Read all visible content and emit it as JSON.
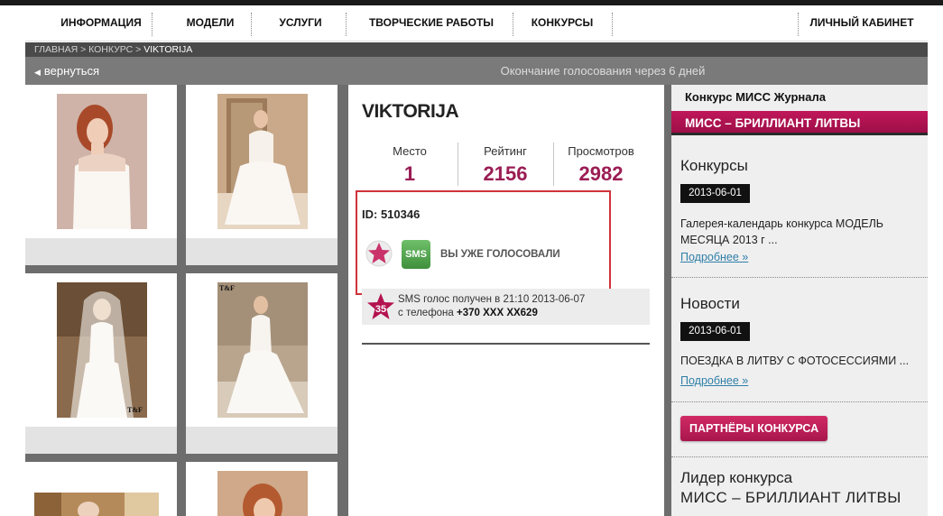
{
  "nav": {
    "items": [
      "ИНФОРМАЦИЯ",
      "МОДЕЛИ",
      "УСЛУГИ",
      "ТВОРЧЕСКИЕ РАБОТЫ",
      "КОНКУРСЫ"
    ],
    "account": "ЛИЧНЫЙ КАБИНЕТ"
  },
  "breadcrumb": {
    "home": "ГЛАВНАЯ",
    "sep": " > ",
    "contest": "КОНКУРС",
    "current": "VIKTORIJA"
  },
  "backbar": {
    "back": "вернуться",
    "voting_end": "Окончание голосования через 6 дней"
  },
  "photos": {
    "watermark": "T&F"
  },
  "profile": {
    "name": "VIKTORIJA",
    "stats": [
      {
        "label": "Место",
        "value": "1"
      },
      {
        "label": "Рейтинг",
        "value": "2156"
      },
      {
        "label": "Просмотров",
        "value": "2982"
      }
    ],
    "id_line": "ID: 510346",
    "sms_label": "SMS",
    "voted_text": "ВЫ УЖЕ ГОЛОСОВАЛИ",
    "sms_log": {
      "badge": "35",
      "line1": "SMS голос получен в 21:10  2013-06-07",
      "line2_prefix": "с телефона ",
      "line2_phone": "+370 XXX XX629"
    }
  },
  "sidebar": {
    "title": "Конкурс МИСС Журнала",
    "banner": "МИСС – БРИЛЛИАНТ ЛИТВЫ",
    "contests": {
      "heading": "Конкурсы",
      "date": "2013-06-01",
      "text": "Галерея-календарь конкурса МОДЕЛЬ МЕСЯЦА 2013 г ...",
      "more": "Подробнее »"
    },
    "news": {
      "heading": "Новости",
      "date": "2013-06-01",
      "text": "ПОЕЗДКА В ЛИТВУ С ФОТОСЕССИЯМИ ...",
      "more": "Подробнее »"
    },
    "partners_button": "ПАРТНЁРЫ КОНКУРСА",
    "leader_line1": "Лидер конкурса",
    "leader_line2": "МИСС – БРИЛЛИАНТ ЛИТВЫ"
  },
  "colors": {
    "accent": "#9b1d54",
    "banner": "#b3124f",
    "link": "#2f7fa8",
    "highlight_box": "#d0323a"
  }
}
